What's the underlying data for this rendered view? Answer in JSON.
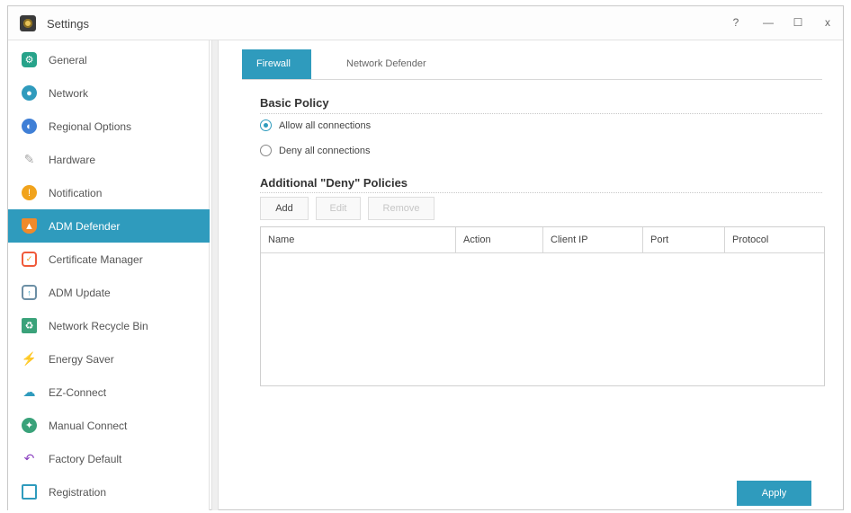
{
  "window": {
    "title": "Settings",
    "controls": {
      "help": "?",
      "minimize": "—",
      "maximize": "☐",
      "close": "x"
    }
  },
  "sidebar": {
    "items": [
      {
        "label": "General",
        "icon": "general-icon",
        "color": "#27a38a"
      },
      {
        "label": "Network",
        "icon": "network-icon",
        "color": "#2f9bbd"
      },
      {
        "label": "Regional Options",
        "icon": "regional-options-icon",
        "color": "#3f7fd6"
      },
      {
        "label": "Hardware",
        "icon": "hardware-icon",
        "color": "#a9a9a9"
      },
      {
        "label": "Notification",
        "icon": "notification-icon",
        "color": "#f1a31c"
      },
      {
        "label": "ADM Defender",
        "icon": "adm-defender-icon",
        "color": "#f08a2a",
        "active": true
      },
      {
        "label": "Certificate Manager",
        "icon": "certificate-manager-icon",
        "color": "#f05a3a"
      },
      {
        "label": "ADM Update",
        "icon": "adm-update-icon",
        "color": "#2f9bbd"
      },
      {
        "label": "Network Recycle Bin",
        "icon": "recycle-bin-icon",
        "color": "#3aa27a"
      },
      {
        "label": "Energy Saver",
        "icon": "energy-saver-icon",
        "color": "#3fb54a"
      },
      {
        "label": "EZ-Connect",
        "icon": "ez-connect-icon",
        "color": "#2f9bbd"
      },
      {
        "label": "Manual Connect",
        "icon": "manual-connect-icon",
        "color": "#3aa27a"
      },
      {
        "label": "Factory Default",
        "icon": "factory-default-icon",
        "color": "#8a3fbf"
      },
      {
        "label": "Registration",
        "icon": "registration-icon",
        "color": "#2f9bbd"
      }
    ]
  },
  "tabs": [
    {
      "label": "Firewall",
      "active": true
    },
    {
      "label": "Network Defender",
      "active": false
    }
  ],
  "basic_policy": {
    "title": "Basic Policy",
    "options": [
      {
        "label": "Allow all connections",
        "checked": true
      },
      {
        "label": "Deny all connections",
        "checked": false
      }
    ]
  },
  "deny_policies": {
    "title": "Additional \"Deny\" Policies",
    "buttons": {
      "add": "Add",
      "edit": "Edit",
      "remove": "Remove"
    },
    "columns": [
      "Name",
      "Action",
      "Client IP",
      "Port",
      "Protocol"
    ],
    "rows": []
  },
  "apply_label": "Apply",
  "accent": "#2f9bbd"
}
